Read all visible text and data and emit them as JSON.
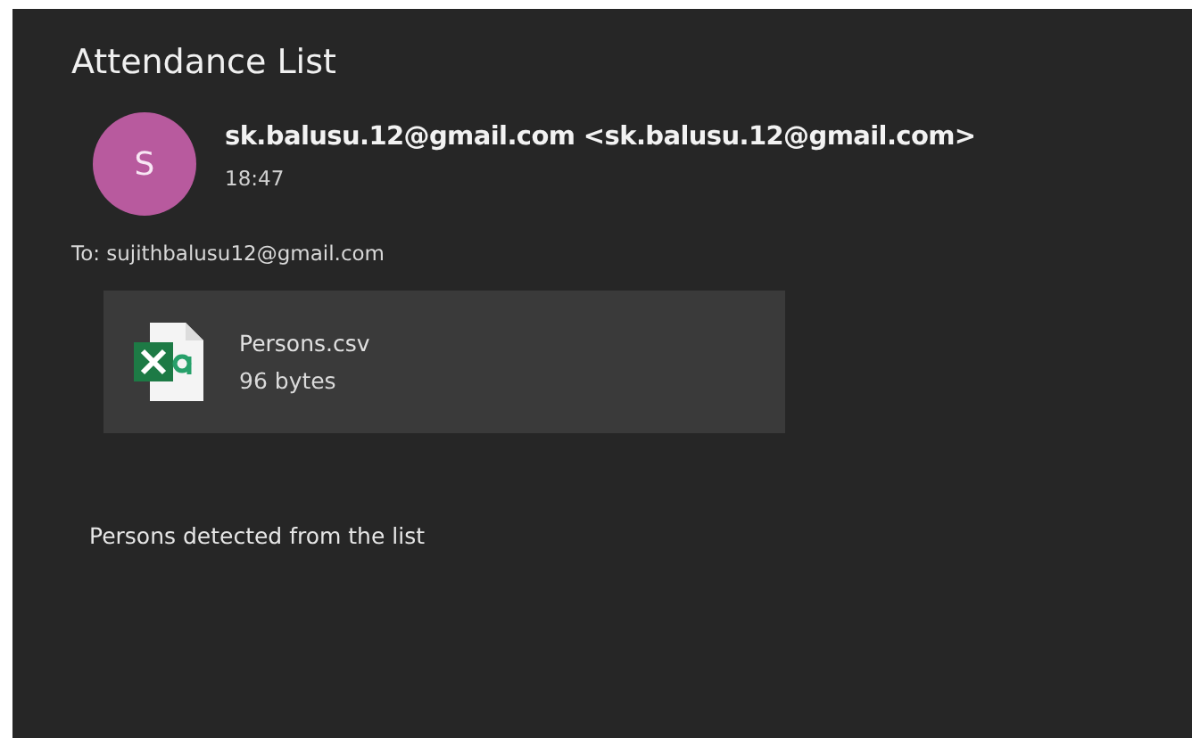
{
  "subject": "Attendance List",
  "sender": {
    "initial": "S",
    "color": "#b85a9e",
    "name": "sk.balusu.12@gmail.com <sk.balusu.12@gmail.com>",
    "time": "18:47"
  },
  "to": "To: sujithbalusu12@gmail.com",
  "attachments": [
    {
      "kind": "spreadsheet",
      "name": "Persons.csv",
      "size": "96 bytes"
    }
  ],
  "body": "Persons detected from the list"
}
